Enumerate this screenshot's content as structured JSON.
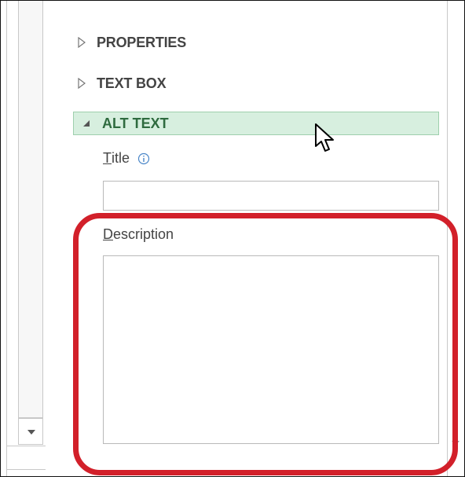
{
  "sections": {
    "properties": {
      "label": "PROPERTIES",
      "expanded": false
    },
    "text_box": {
      "label": "TEXT BOX",
      "expanded": false
    },
    "alt_text": {
      "label": "ALT TEXT",
      "expanded": true
    }
  },
  "alt_text_form": {
    "title_label_accesskey": "T",
    "title_label_rest": "itle",
    "title_value": "",
    "description_label_accesskey": "D",
    "description_label_rest": "escription",
    "description_value": ""
  },
  "icons": {
    "collapsed": "triangle-outline-right",
    "expanded": "triangle-solid-down-right",
    "info": "info-circle-icon",
    "cursor": "mouse-pointer-icon",
    "scroll_down": "scroll-down-arrow"
  },
  "colors": {
    "alt_header_bg": "#d7efdf",
    "alt_header_border": "#9ecfad",
    "alt_header_text": "#2f6b3f",
    "highlight_ring": "#d2202a"
  }
}
